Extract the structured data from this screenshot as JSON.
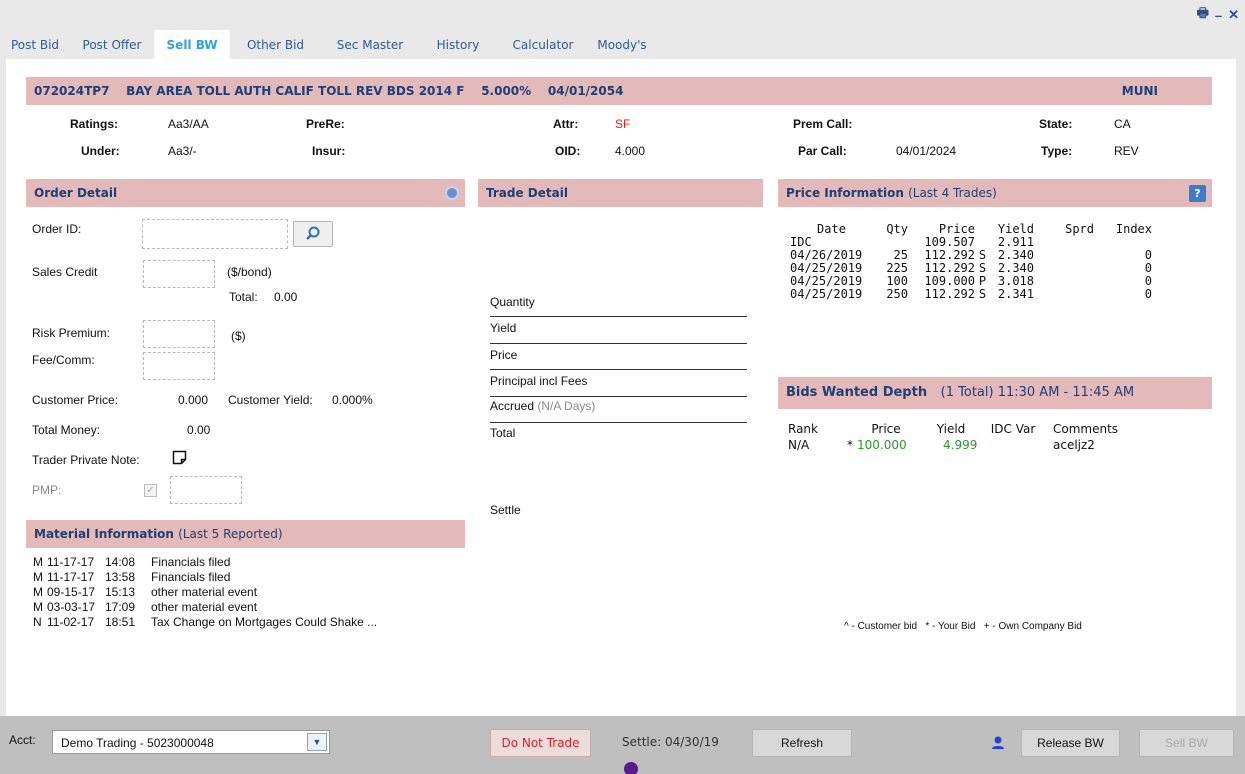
{
  "window": {
    "icons": [
      "print-icon",
      "minimize-icon",
      "close-icon"
    ],
    "print": "🖶",
    "minimize": "–",
    "close": "✕"
  },
  "tabs": [
    "Post Bid",
    "Post Offer",
    "Sell BW",
    "Other Bid",
    "Sec Master",
    "History",
    "Calculator",
    "Moody's"
  ],
  "active_tab": "Sell BW",
  "security": {
    "cusip": "072024TP7",
    "description": "BAY AREA TOLL AUTH CALIF TOLL REV BDS 2014 F",
    "coupon": "5.000%",
    "maturity": "04/01/2054",
    "type_label": "MUNI"
  },
  "details": {
    "ratings_label": "Ratings:",
    "ratings": "Aa3/AA",
    "prere_label": "PreRe:",
    "prere": "",
    "attr_label": "Attr:",
    "attr": "SF",
    "premcall_label": "Prem Call:",
    "premcall": "",
    "state_label": "State:",
    "state": "CA",
    "under_label": "Under:",
    "under": "Aa3/-",
    "insur_label": "Insur:",
    "insur": "",
    "oid_label": "OID:",
    "oid": "4.000",
    "parcall_label": "Par Call:",
    "parcall": "04/01/2024",
    "type_label": "Type:",
    "type": "REV"
  },
  "order": {
    "title": "Order Detail",
    "order_id_label": "Order ID:",
    "order_id": "",
    "sales_credit_label": "Sales Credit",
    "sales_credit_unit": "($/bond)",
    "total_label": "Total:",
    "total": "0.00",
    "risk_label": "Risk Premium:",
    "risk_unit": "($)",
    "fee_label": "Fee/Comm:",
    "cust_price_label": "Customer Price:",
    "cust_price": "0.000",
    "cust_yield_label": "Customer Yield:",
    "cust_yield": "0.000%",
    "total_money_label": "Total Money:",
    "total_money": "0.00",
    "trader_note_label": "Trader Private Note:",
    "pmp_label": "PMP:"
  },
  "trade": {
    "title": "Trade Detail",
    "quantity": "Quantity",
    "yield": "Yield",
    "price": "Price",
    "principal": "Principal incl Fees",
    "accrued": "Accrued",
    "accrued_days": "(N/A Days)",
    "total": "Total",
    "settle": "Settle"
  },
  "price_info": {
    "title": "Price Information",
    "subtitle": "(Last 4 Trades)",
    "help": "?",
    "headers": [
      "Date",
      "Qty",
      "Price",
      "",
      "Yield",
      "Sprd",
      "Index"
    ],
    "rows": [
      [
        "IDC",
        "",
        "109.507",
        "",
        "2.911",
        "",
        ""
      ],
      [
        "04/26/2019",
        "25",
        "112.292",
        "S",
        "2.340",
        "",
        "0"
      ],
      [
        "04/25/2019",
        "225",
        "112.292",
        "S",
        "2.340",
        "",
        "0"
      ],
      [
        "04/25/2019",
        "100",
        "109.000",
        "P",
        "3.018",
        "",
        "0"
      ],
      [
        "04/25/2019",
        "250",
        "112.292",
        "S",
        "2.341",
        "",
        "0"
      ]
    ]
  },
  "bids": {
    "title": "Bids Wanted Depth",
    "subtitle": "(1  Total) 11:30 AM - 11:45 AM",
    "headers": [
      "Rank",
      "Price",
      "Yield",
      "IDC Var",
      "Comments"
    ],
    "rows": [
      [
        "N/A",
        "*",
        "100.000",
        "4.999",
        "",
        "aceljz2"
      ]
    ],
    "legend": "^ - Customer bid   * - Your Bid   + - Own Company Bid"
  },
  "material": {
    "title": "Material Information",
    "subtitle": "(Last 5 Reported)",
    "rows": [
      [
        "M",
        "11-17-17",
        "14:08",
        "Financials filed"
      ],
      [
        "M",
        "11-17-17",
        "13:58",
        "Financials filed"
      ],
      [
        "M",
        "09-15-17",
        "15:13",
        "other material event"
      ],
      [
        "M",
        "03-03-17",
        "17:09",
        "other material event"
      ],
      [
        "N",
        "11-02-17",
        "18:51",
        "Tax Change on Mortgages Could Shake ..."
      ]
    ]
  },
  "footer": {
    "acct_label": "Acct:",
    "acct_value": "Demo Trading - 5023000048",
    "do_not_trade": "Do Not Trade",
    "settle": "Settle: 04/30/19",
    "refresh": "Refresh",
    "release": "Release BW",
    "sell": "Sell BW"
  },
  "colors": {
    "header_bg": "#e3b9ba",
    "header_text": "#1f3f77",
    "active_tab": "#2ea3dd",
    "attr_red": "#e02020",
    "bid_green": "#2a9a2a"
  }
}
